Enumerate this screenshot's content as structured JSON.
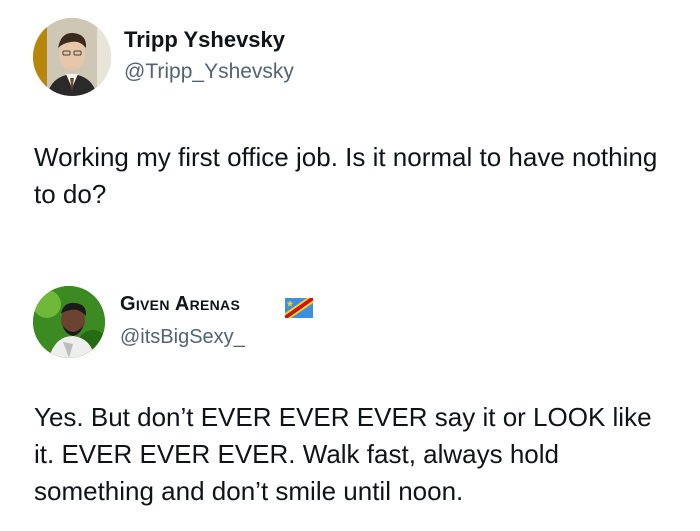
{
  "tweets": [
    {
      "author": {
        "name": "Tripp Yshevsky",
        "handle": "@Tripp_Yshevsky"
      },
      "text": "Working my first office job. Is it normal to have nothing to do?"
    },
    {
      "author": {
        "name": "Given Arenas",
        "handle": "@itsBigSexy_",
        "flag_icon": "dr-congo-flag-icon"
      },
      "text": "Yes. But don’t EVER EVER EVER say it or LOOK like it. EVER EVER EVER. Walk fast, always hold something and don’t smile until noon."
    }
  ]
}
